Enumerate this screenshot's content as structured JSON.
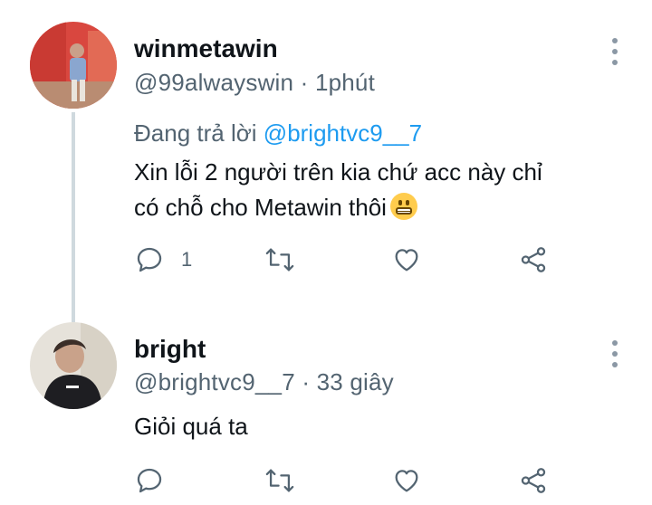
{
  "tweets": [
    {
      "display_name": "winmetawin",
      "handle": "@99alwayswin",
      "separator": "·",
      "time": "1phút",
      "replying_prefix": "Đang trả lời",
      "replying_to": "@brightvc9__7",
      "text_line1": "Xin lỗi 2 người trên kia chứ acc này chỉ",
      "text_line2": "có chỗ cho Metawin thôi",
      "emoji": "grimacing-face",
      "reply_count": "1"
    },
    {
      "display_name": "bright",
      "handle": "@brightvc9__7",
      "separator": "·",
      "time": "33 giây",
      "text_line1": "Giỏi quá ta",
      "reply_count": ""
    }
  ],
  "colors": {
    "text": "#0f1419",
    "secondary": "#536471",
    "mention": "#1d9bf0",
    "thread_line": "#cfd9de"
  }
}
